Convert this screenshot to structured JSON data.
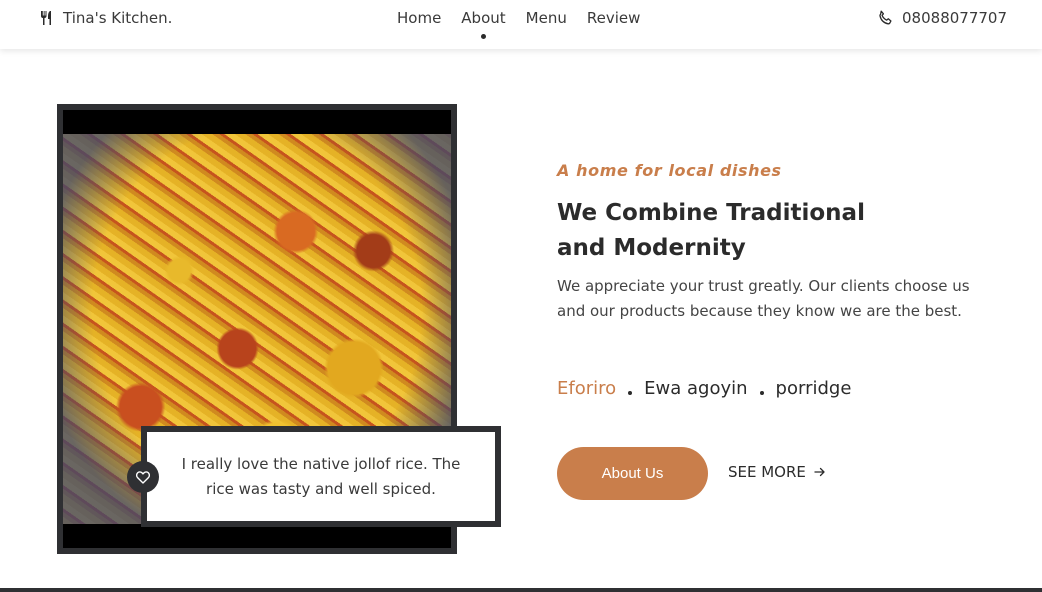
{
  "header": {
    "brand_icon": "fork-knife-icon",
    "brand_name": "Tina's Kitchen.",
    "nav": [
      {
        "label": "Home"
      },
      {
        "label": "About"
      },
      {
        "label": "Menu"
      },
      {
        "label": "Review"
      }
    ],
    "active_nav": "About",
    "phone_icon": "phone-icon",
    "phone_number": "08088077707"
  },
  "gallery": {
    "image_subject": "jollof rice",
    "review": "I really love the native jollof rice. The rice was tasty and well spiced.",
    "badge_icon": "heart-icon"
  },
  "about": {
    "tagline": "A home for local dishes",
    "heading": "We Combine Traditional and Modernity",
    "description": "We appreciate your trust greatly. Our clients choose us and our products because they know we are the best.",
    "dishes": [
      "Eforiro",
      "Ewa agoyin",
      "porridge"
    ],
    "primary_button": "About Us",
    "secondary_link": "SEE MORE",
    "secondary_icon": "arrow-right-icon"
  },
  "colors": {
    "accent": "#c97e4b",
    "dark": "#2f3033",
    "text": "#2b2b2b"
  }
}
